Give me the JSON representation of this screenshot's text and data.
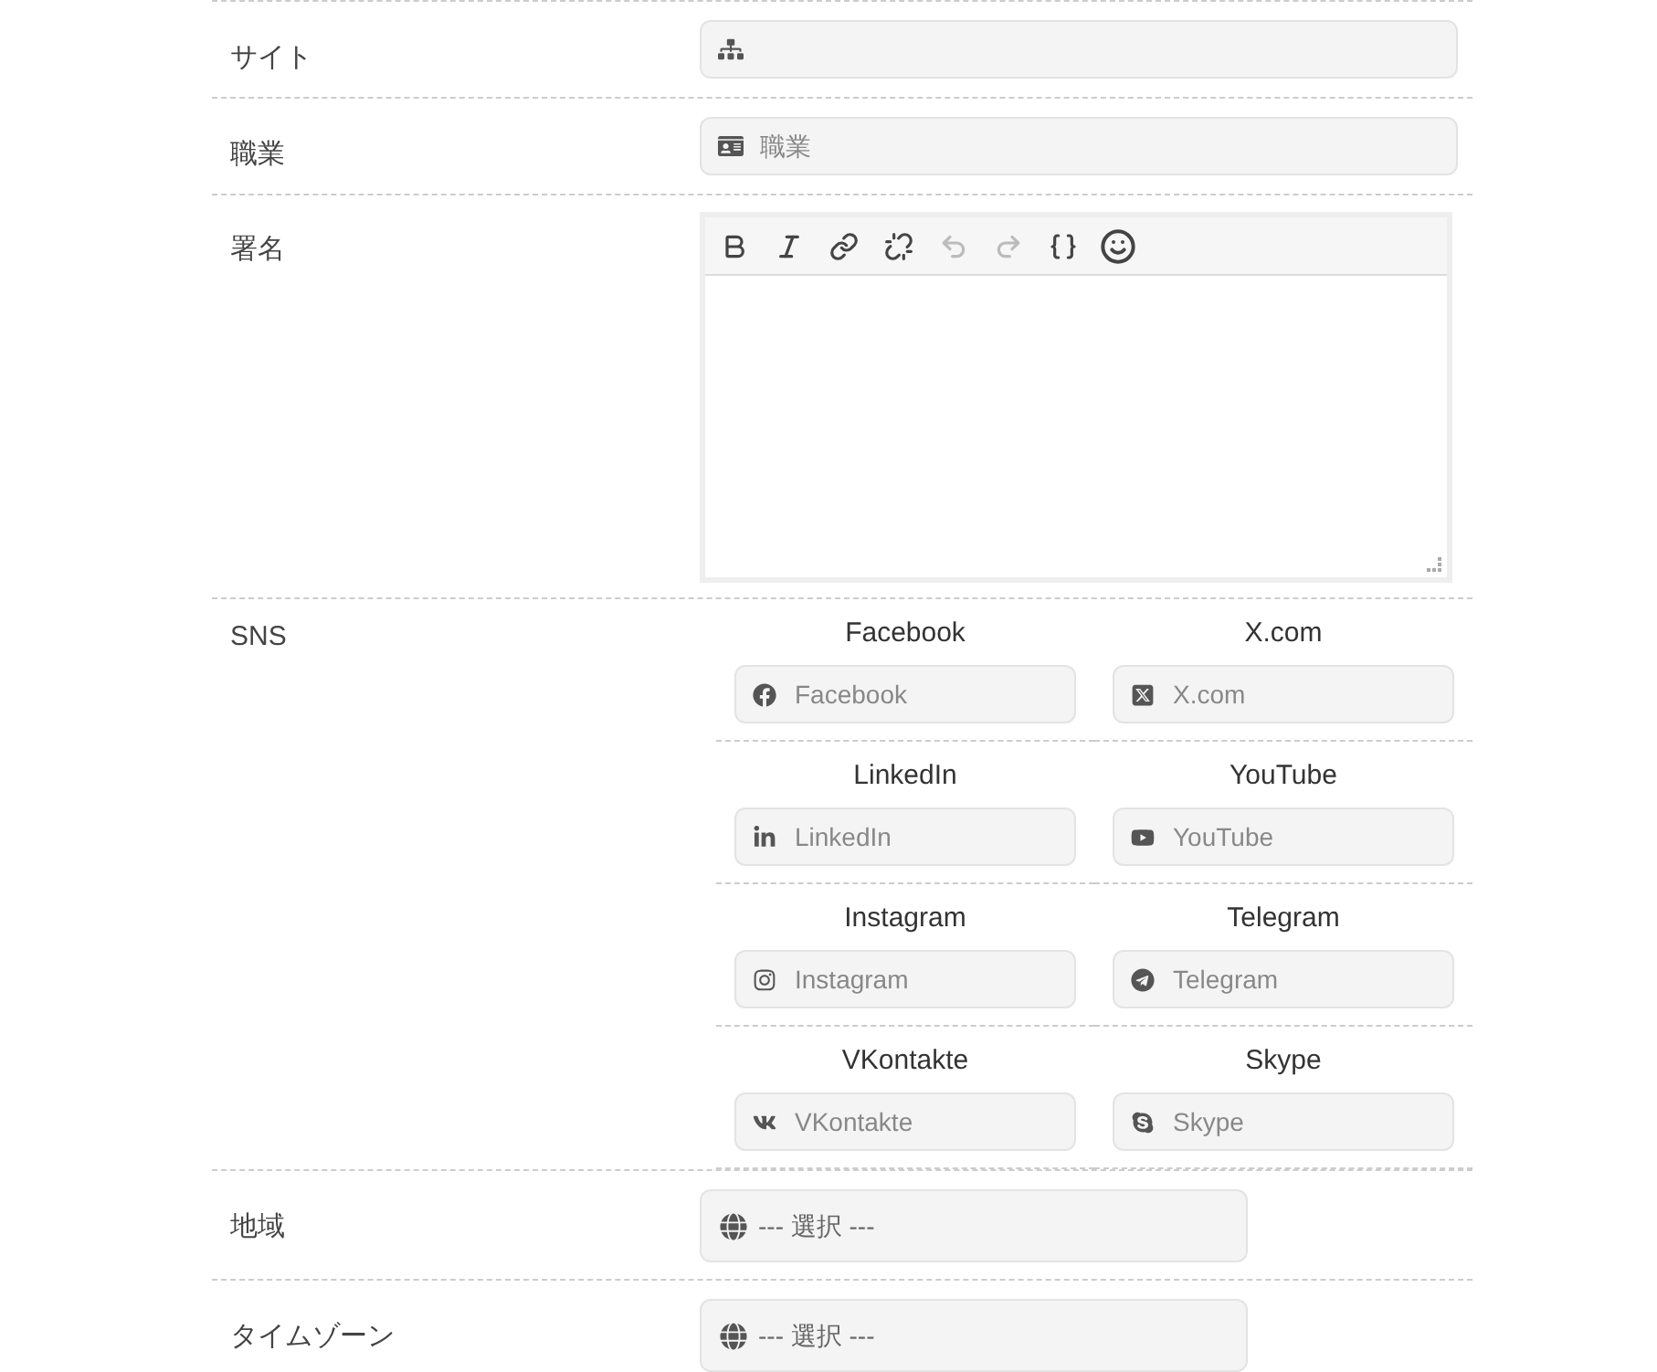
{
  "rows": [
    {
      "kind": "site",
      "label": "サイト"
    },
    {
      "kind": "job",
      "label": "職業",
      "placeholder": "職業"
    },
    {
      "kind": "editor",
      "label": "署名",
      "toolbar": [
        {
          "kind": "bold",
          "disabled": false
        },
        {
          "kind": "italic",
          "disabled": false
        },
        {
          "kind": "link",
          "disabled": false
        },
        {
          "kind": "unlink",
          "disabled": false
        },
        {
          "kind": "undo",
          "disabled": true
        },
        {
          "kind": "redo",
          "disabled": true
        },
        {
          "kind": "code",
          "disabled": false
        },
        {
          "kind": "emoji",
          "disabled": false
        }
      ]
    },
    {
      "kind": "social",
      "label": "SNS",
      "networks": [
        {
          "kind": "facebook",
          "title": "Facebook",
          "placeholder": "Facebook"
        },
        {
          "kind": "x",
          "title": "X.com",
          "placeholder": "X.com"
        },
        {
          "kind": "linkedin",
          "title": "LinkedIn",
          "placeholder": "LinkedIn"
        },
        {
          "kind": "youtube",
          "title": "YouTube",
          "placeholder": "YouTube"
        },
        {
          "kind": "instagram",
          "title": "Instagram",
          "placeholder": "Instagram"
        },
        {
          "kind": "telegram",
          "title": "Telegram",
          "placeholder": "Telegram"
        },
        {
          "kind": "vk",
          "title": "VKontakte",
          "placeholder": "VKontakte"
        },
        {
          "kind": "skype",
          "title": "Skype",
          "placeholder": "Skype"
        }
      ]
    },
    {
      "kind": "select",
      "label": "地域",
      "value": "--- 選択 ---"
    },
    {
      "kind": "select",
      "label": "タイムゾーン",
      "value": "--- 選択 ---"
    }
  ]
}
